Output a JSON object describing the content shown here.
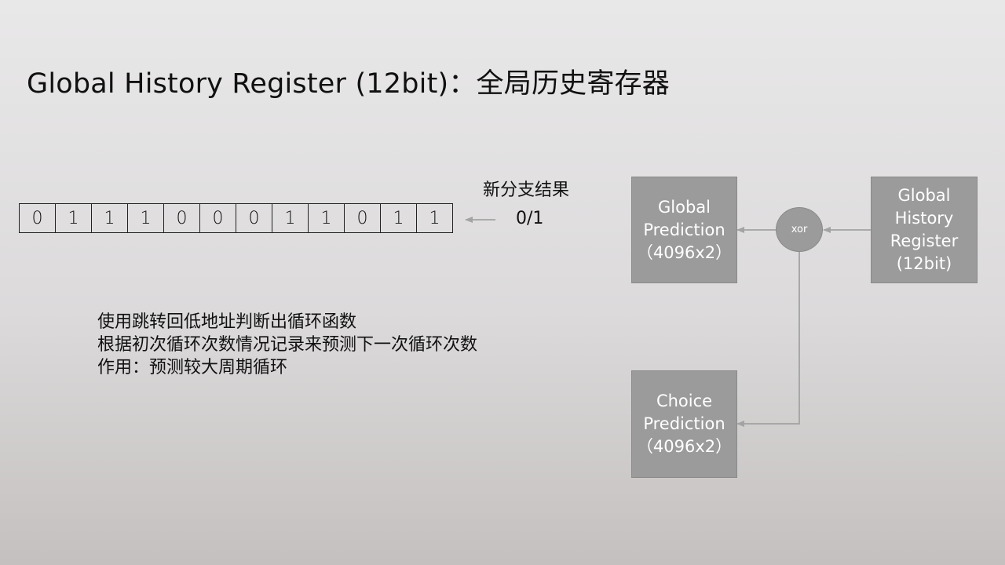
{
  "title": "Global History Register (12bit)：全局历史寄存器",
  "register": {
    "bits": [
      "0",
      "1",
      "1",
      "1",
      "0",
      "0",
      "0",
      "1",
      "1",
      "0",
      "1",
      "1"
    ],
    "new_result_label": "新分支结果",
    "input_value": "0/1"
  },
  "notes": [
    "使用跳转回低地址判断出循环函数",
    "根据初次循环次数情况记录来预测下一次循环次数",
    "作用：预测较大周期循环"
  ],
  "blocks": {
    "global_prediction": [
      "Global",
      "Prediction",
      "（4096x2）"
    ],
    "global_history": [
      "Global",
      "History",
      "Register",
      "(12bit)"
    ],
    "choice_prediction": [
      "Choice",
      "Prediction",
      "（4096x2）"
    ],
    "xor_label": "xor"
  },
  "colors": {
    "block_fill": "#9b9b9b",
    "block_text": "#ffffff",
    "arrow": "#a3a3a3"
  }
}
